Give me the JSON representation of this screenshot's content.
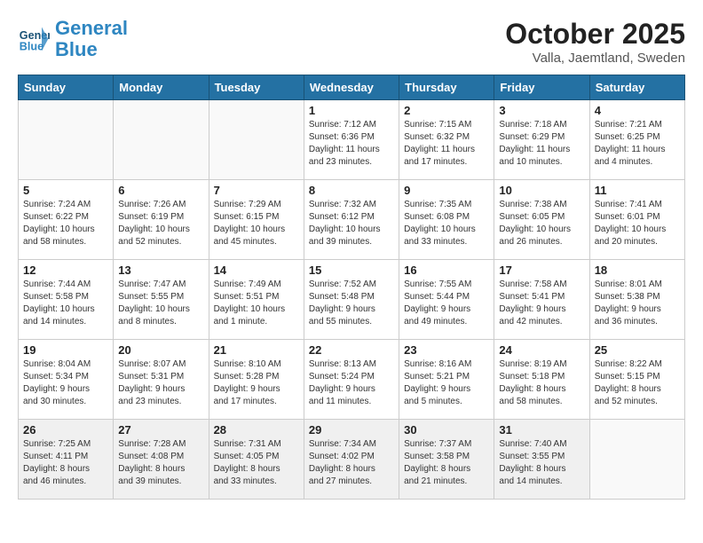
{
  "logo": {
    "line1": "General",
    "line2": "Blue"
  },
  "title": "October 2025",
  "location": "Valla, Jaemtland, Sweden",
  "weekdays": [
    "Sunday",
    "Monday",
    "Tuesday",
    "Wednesday",
    "Thursday",
    "Friday",
    "Saturday"
  ],
  "weeks": [
    [
      {
        "day": "",
        "info": ""
      },
      {
        "day": "",
        "info": ""
      },
      {
        "day": "",
        "info": ""
      },
      {
        "day": "1",
        "info": "Sunrise: 7:12 AM\nSunset: 6:36 PM\nDaylight: 11 hours\nand 23 minutes."
      },
      {
        "day": "2",
        "info": "Sunrise: 7:15 AM\nSunset: 6:32 PM\nDaylight: 11 hours\nand 17 minutes."
      },
      {
        "day": "3",
        "info": "Sunrise: 7:18 AM\nSunset: 6:29 PM\nDaylight: 11 hours\nand 10 minutes."
      },
      {
        "day": "4",
        "info": "Sunrise: 7:21 AM\nSunset: 6:25 PM\nDaylight: 11 hours\nand 4 minutes."
      }
    ],
    [
      {
        "day": "5",
        "info": "Sunrise: 7:24 AM\nSunset: 6:22 PM\nDaylight: 10 hours\nand 58 minutes."
      },
      {
        "day": "6",
        "info": "Sunrise: 7:26 AM\nSunset: 6:19 PM\nDaylight: 10 hours\nand 52 minutes."
      },
      {
        "day": "7",
        "info": "Sunrise: 7:29 AM\nSunset: 6:15 PM\nDaylight: 10 hours\nand 45 minutes."
      },
      {
        "day": "8",
        "info": "Sunrise: 7:32 AM\nSunset: 6:12 PM\nDaylight: 10 hours\nand 39 minutes."
      },
      {
        "day": "9",
        "info": "Sunrise: 7:35 AM\nSunset: 6:08 PM\nDaylight: 10 hours\nand 33 minutes."
      },
      {
        "day": "10",
        "info": "Sunrise: 7:38 AM\nSunset: 6:05 PM\nDaylight: 10 hours\nand 26 minutes."
      },
      {
        "day": "11",
        "info": "Sunrise: 7:41 AM\nSunset: 6:01 PM\nDaylight: 10 hours\nand 20 minutes."
      }
    ],
    [
      {
        "day": "12",
        "info": "Sunrise: 7:44 AM\nSunset: 5:58 PM\nDaylight: 10 hours\nand 14 minutes."
      },
      {
        "day": "13",
        "info": "Sunrise: 7:47 AM\nSunset: 5:55 PM\nDaylight: 10 hours\nand 8 minutes."
      },
      {
        "day": "14",
        "info": "Sunrise: 7:49 AM\nSunset: 5:51 PM\nDaylight: 10 hours\nand 1 minute."
      },
      {
        "day": "15",
        "info": "Sunrise: 7:52 AM\nSunset: 5:48 PM\nDaylight: 9 hours\nand 55 minutes."
      },
      {
        "day": "16",
        "info": "Sunrise: 7:55 AM\nSunset: 5:44 PM\nDaylight: 9 hours\nand 49 minutes."
      },
      {
        "day": "17",
        "info": "Sunrise: 7:58 AM\nSunset: 5:41 PM\nDaylight: 9 hours\nand 42 minutes."
      },
      {
        "day": "18",
        "info": "Sunrise: 8:01 AM\nSunset: 5:38 PM\nDaylight: 9 hours\nand 36 minutes."
      }
    ],
    [
      {
        "day": "19",
        "info": "Sunrise: 8:04 AM\nSunset: 5:34 PM\nDaylight: 9 hours\nand 30 minutes."
      },
      {
        "day": "20",
        "info": "Sunrise: 8:07 AM\nSunset: 5:31 PM\nDaylight: 9 hours\nand 23 minutes."
      },
      {
        "day": "21",
        "info": "Sunrise: 8:10 AM\nSunset: 5:28 PM\nDaylight: 9 hours\nand 17 minutes."
      },
      {
        "day": "22",
        "info": "Sunrise: 8:13 AM\nSunset: 5:24 PM\nDaylight: 9 hours\nand 11 minutes."
      },
      {
        "day": "23",
        "info": "Sunrise: 8:16 AM\nSunset: 5:21 PM\nDaylight: 9 hours\nand 5 minutes."
      },
      {
        "day": "24",
        "info": "Sunrise: 8:19 AM\nSunset: 5:18 PM\nDaylight: 8 hours\nand 58 minutes."
      },
      {
        "day": "25",
        "info": "Sunrise: 8:22 AM\nSunset: 5:15 PM\nDaylight: 8 hours\nand 52 minutes."
      }
    ],
    [
      {
        "day": "26",
        "info": "Sunrise: 7:25 AM\nSunset: 4:11 PM\nDaylight: 8 hours\nand 46 minutes."
      },
      {
        "day": "27",
        "info": "Sunrise: 7:28 AM\nSunset: 4:08 PM\nDaylight: 8 hours\nand 39 minutes."
      },
      {
        "day": "28",
        "info": "Sunrise: 7:31 AM\nSunset: 4:05 PM\nDaylight: 8 hours\nand 33 minutes."
      },
      {
        "day": "29",
        "info": "Sunrise: 7:34 AM\nSunset: 4:02 PM\nDaylight: 8 hours\nand 27 minutes."
      },
      {
        "day": "30",
        "info": "Sunrise: 7:37 AM\nSunset: 3:58 PM\nDaylight: 8 hours\nand 21 minutes."
      },
      {
        "day": "31",
        "info": "Sunrise: 7:40 AM\nSunset: 3:55 PM\nDaylight: 8 hours\nand 14 minutes."
      },
      {
        "day": "",
        "info": ""
      }
    ]
  ]
}
